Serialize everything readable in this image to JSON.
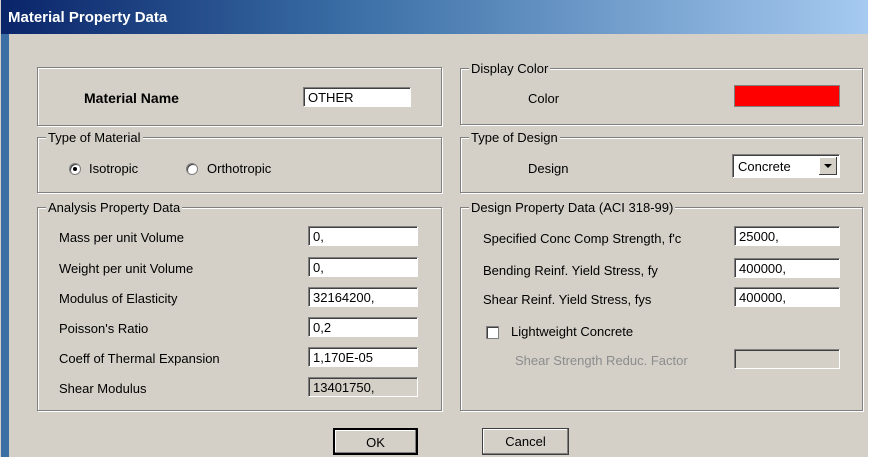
{
  "window": {
    "title": "Material Property Data"
  },
  "material": {
    "label": "Material Name",
    "value": "OTHER"
  },
  "type_of_material": {
    "legend": "Type of Material",
    "isotropic": "Isotropic",
    "orthotropic": "Orthotropic",
    "selected": "Isotropic"
  },
  "analysis": {
    "legend": "Analysis Property Data",
    "rows": [
      {
        "label": "Mass per unit Volume",
        "value": "0,"
      },
      {
        "label": "Weight per unit Volume",
        "value": "0,"
      },
      {
        "label": "Modulus of Elasticity",
        "value": "32164200,"
      },
      {
        "label": "Poisson's Ratio",
        "value": "0,2"
      },
      {
        "label": "Coeff of Thermal Expansion",
        "value": "1,170E-05"
      },
      {
        "label": "Shear Modulus",
        "value": "13401750,"
      }
    ]
  },
  "display_color": {
    "legend": "Display Color",
    "label": "Color",
    "color": "#ff0000"
  },
  "type_of_design": {
    "legend": "Type of Design",
    "label": "Design",
    "value": "Concrete"
  },
  "design": {
    "legend": "Design Property Data (ACI 318-99)",
    "rows": [
      {
        "label": "Specified Conc Comp Strength, f'c",
        "value": "25000,"
      },
      {
        "label": "Bending Reinf. Yield Stress, fy",
        "value": "400000,"
      },
      {
        "label": "Shear Reinf. Yield Stress, fys",
        "value": "400000,"
      }
    ],
    "lightweight_label": "Lightweight Concrete",
    "lightweight_checked": false,
    "reduc_label": "Shear Strength Reduc. Factor",
    "reduc_value": ""
  },
  "buttons": {
    "ok": "OK",
    "cancel": "Cancel"
  }
}
